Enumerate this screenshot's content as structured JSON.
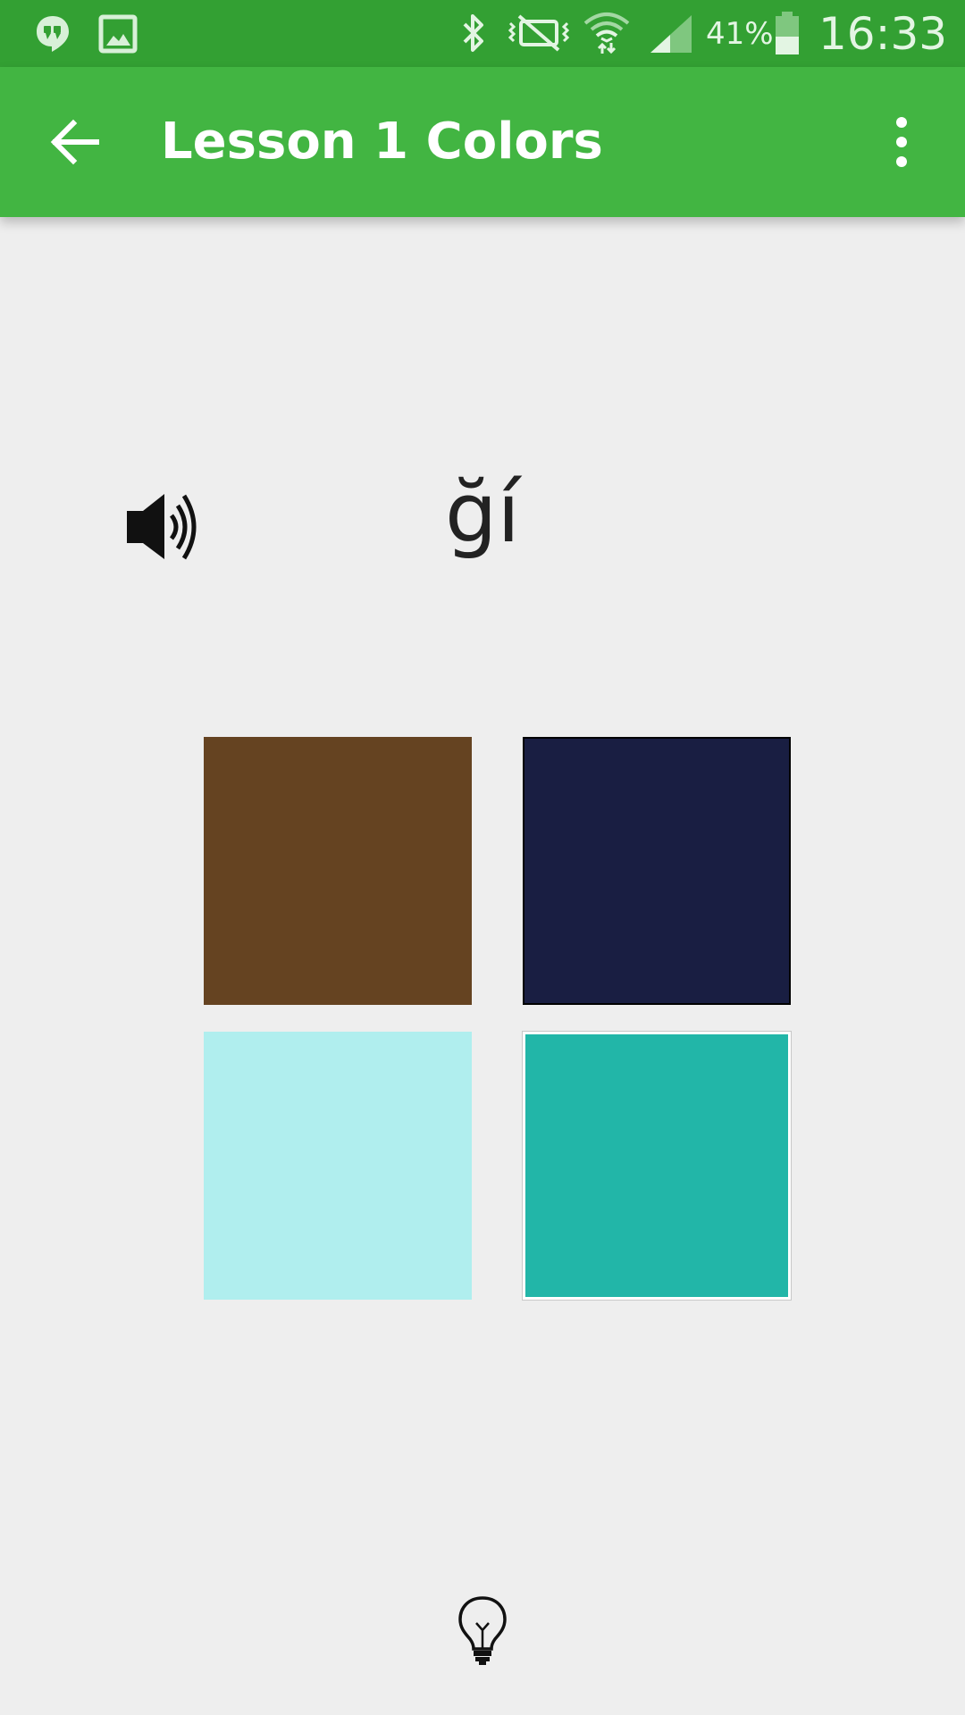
{
  "status_bar": {
    "battery_percent": "41%",
    "time": "16:33",
    "icons": [
      "hangouts-icon",
      "gallery-icon",
      "bluetooth-icon",
      "vibrate-icon",
      "wifi-icon",
      "signal-icon",
      "battery-icon"
    ]
  },
  "app_bar": {
    "title": "Lesson 1 Colors",
    "back_icon": "arrow-back-icon",
    "menu_icon": "more-vert-icon"
  },
  "question": {
    "word": "ğí",
    "speaker_icon": "speaker-icon"
  },
  "choices": [
    {
      "name": "brown",
      "color": "#654321"
    },
    {
      "name": "navy",
      "color": "#191e42"
    },
    {
      "name": "pale-turquoise",
      "color": "#b0eeee"
    },
    {
      "name": "light-sea-green",
      "color": "#22b6a8"
    }
  ],
  "hint": {
    "icon": "lightbulb-icon"
  },
  "colors": {
    "status_bar": "#33a033",
    "app_bar": "#42b542",
    "background": "#eeeeee"
  }
}
